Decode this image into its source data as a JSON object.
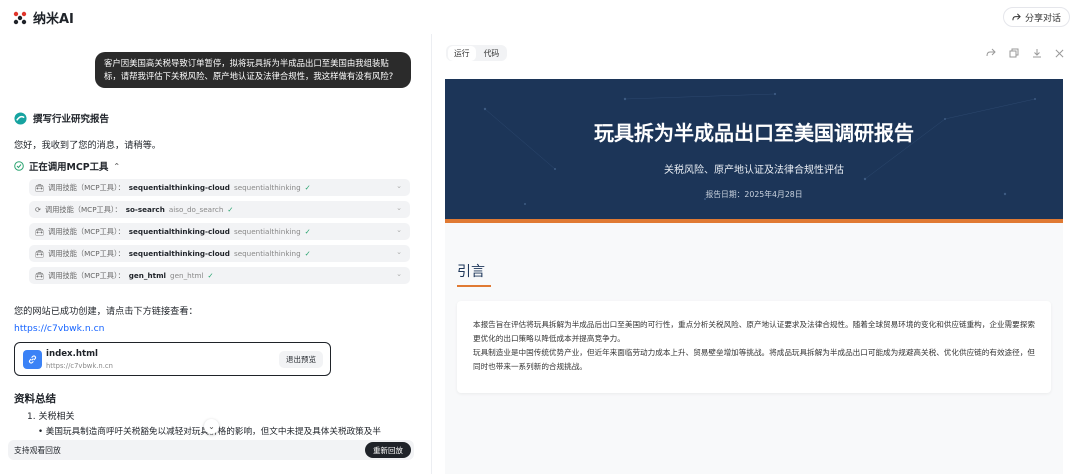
{
  "app": {
    "name": "纳米AI",
    "share_label": "分享对话"
  },
  "chat": {
    "user_message": "客户因美国高关税导致订单暂停，拟将玩具拆为半成品出口至美国由我组装贴标，请帮我评估下关税风险、原产地认证及法律合规性，我这样做有没有风险?",
    "step_title": "撰写行业研究报告",
    "wait_message": "您好，我收到了您的消息，请稍等。",
    "mcp_heading": "正在调用MCP工具",
    "tools": [
      {
        "prefix": "调用技能（MCP工具）：",
        "name": "sequentialthinking-cloud",
        "fn": "sequentialthinking",
        "icon": "toolbox-icon"
      },
      {
        "prefix": "调用技能（MCP工具）：",
        "name": "so-search",
        "fn": "aiso_do_search",
        "icon": "search-icon"
      },
      {
        "prefix": "调用技能（MCP工具）：",
        "name": "sequentialthinking-cloud",
        "fn": "sequentialthinking",
        "icon": "toolbox-icon"
      },
      {
        "prefix": "调用技能（MCP工具）：",
        "name": "sequentialthinking-cloud",
        "fn": "sequentialthinking",
        "icon": "toolbox-icon"
      },
      {
        "prefix": "调用技能（MCP工具）：",
        "name": "gen_html",
        "fn": "gen_html",
        "icon": "toolbox-icon"
      }
    ],
    "site_created": "您的网站已成功创建，请点击下方链接查看：",
    "site_link": "https://c7vbwk.n.cn",
    "file": {
      "name": "index.html",
      "url": "https://c7vbwk.n.cn",
      "exit_label": "退出预览"
    },
    "summary_title": "资料总结",
    "summary_item_1": "1. 关税相关",
    "summary_bullet_1": "• 美国玩具制造商呼吁关税豁免以减轻对玩具价格的影响，但文中未提及具体关税政策及半",
    "replay_text": "支持观看回放",
    "replay_button": "重新回放"
  },
  "panel": {
    "tabs": [
      "运行",
      "代码"
    ],
    "report": {
      "title": "玩具拆为半成品出口至美国调研报告",
      "subtitle": "关税风险、原产地认证及法律合规性评估",
      "date": "报告日期：2025年4月28日",
      "section_title": "引言",
      "para1": "本报告旨在评估将玩具拆解为半成品后出口至美国的可行性，重点分析关税风险、原产地认证要求及法律合规性。随着全球贸易环境的变化和供应链重构，企业需要探索更优化的出口策略以降低成本并提高竞争力。",
      "para2": "玩具制造业是中国传统优势产业，但近年来面临劳动力成本上升、贸易壁垒增加等挑战。将成品玩具拆解为半成品出口可能成为规避高关税、优化供应链的有效途径，但同时也带来一系列新的合规挑战。"
    }
  },
  "colors": {
    "hero_bg": "#1c3558",
    "accent": "#e07a33",
    "link": "#1664ff",
    "check": "#2ba471"
  }
}
